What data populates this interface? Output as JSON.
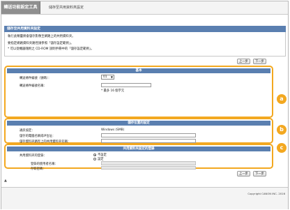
{
  "header": {
    "logo": "轉送功能設定工具",
    "title": "儲存至共用資料夾設定"
  },
  "section": {
    "title": "儲存至共用資料夾設定",
    "intro": [
      "執行此精靈將會儲存影像至網路上的共用資料夾。",
      "要指定網路資料夾路徑請參照「儲存設定範例」。",
      "* 可以從機器隨附之 CD-ROM 說明手冊中的「儲存設定範例」。"
    ]
  },
  "nav": {
    "prev": "上一步",
    "next": "下一步"
  },
  "groups": {
    "a": {
      "badge": "a",
      "title": "基本",
      "condition_number_label": "轉送條件編號（號碼）：",
      "condition_number_value": "01",
      "condition_name_label": "轉送條件編號名稱：",
      "condition_name_note": "* 最多 16 個字元"
    },
    "b": {
      "badge": "b",
      "title": "儲存位置的設定",
      "protocol_label": "通訊協定：",
      "protocol_value": "Windows (SMB)",
      "host_label": "儲存的電腦名稱或IP位址：",
      "folder_label": "儲存資料夾路徑上的共用資料夾名稱："
    },
    "c": {
      "badge": "c",
      "title": "共用資料夾設定的登錄",
      "mode_label": "共用資料夾的登錄：",
      "options": [
        "不設定",
        "設定"
      ],
      "user_label": "登錄的使用者名稱：",
      "password_label": "存取密碼："
    }
  },
  "footer": {
    "top_icon": "▲",
    "copyright": "Copyright CANON INC. 2016"
  },
  "colors": {
    "accent": "#f3a820",
    "section": "#5a7fb0"
  }
}
